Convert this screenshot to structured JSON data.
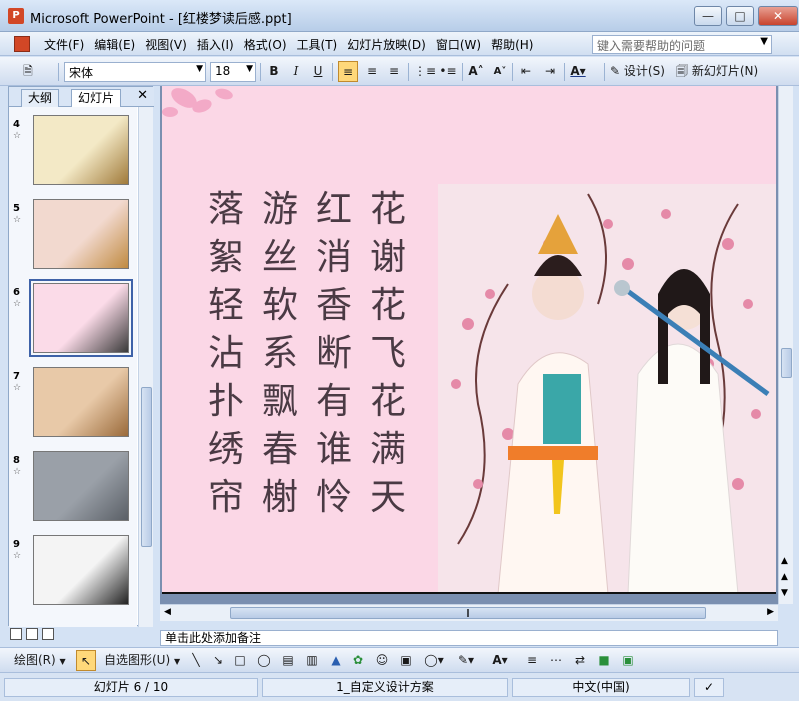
{
  "window": {
    "title": "Microsoft PowerPoint - [红楼梦读后感.ppt]",
    "app_icon_label": "P"
  },
  "menubar": {
    "items": [
      "文件(F)",
      "编辑(E)",
      "视图(V)",
      "插入(I)",
      "格式(O)",
      "工具(T)",
      "幻灯片放映(D)",
      "窗口(W)",
      "帮助(H)"
    ],
    "help_placeholder": "键入需要帮助的问题"
  },
  "toolbar": {
    "font_name": "宋体",
    "font_size": "18",
    "bold": "B",
    "italic": "I",
    "underline": "U",
    "design_label": "设计(S)",
    "new_slide_label": "新幻灯片(N)"
  },
  "left_pane": {
    "tabs": [
      "大纲",
      "幻灯片"
    ],
    "active_tab": "幻灯片",
    "slides": [
      {
        "number": "4",
        "selected": false
      },
      {
        "number": "5",
        "selected": false
      },
      {
        "number": "6",
        "selected": true
      },
      {
        "number": "7",
        "selected": false
      },
      {
        "number": "8",
        "selected": false
      },
      {
        "number": "9",
        "selected": false
      }
    ],
    "star": "☆"
  },
  "slide": {
    "poem_columns": [
      [
        "落",
        "絮",
        "轻",
        "沾",
        "扑",
        "绣",
        "帘"
      ],
      [
        "游",
        "丝",
        "软",
        "系",
        "飘",
        "春",
        "榭"
      ],
      [
        "红",
        "消",
        "香",
        "断",
        "有",
        "谁",
        "怜"
      ],
      [
        "花",
        "谢",
        "花",
        "飞",
        "花",
        "满",
        "天"
      ]
    ],
    "background_color": "#fbd7e6"
  },
  "notes_placeholder": "单击此处添加备注",
  "drawbar": {
    "draw_label": "绘图(R)",
    "autoshapes_label": "自选图形(U)"
  },
  "statusbar": {
    "slide_info": "幻灯片 6 / 10",
    "design": "1_自定义设计方案",
    "language": "中文(中国)"
  }
}
